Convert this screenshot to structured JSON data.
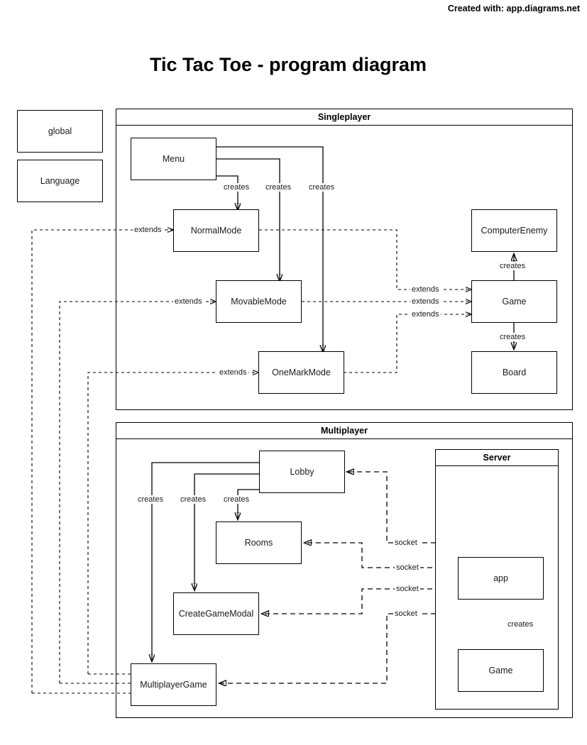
{
  "credit": "Created with: app.diagrams.net",
  "title": "Tic Tac Toe - program diagram",
  "standalone_nodes": [
    {
      "label": "global"
    },
    {
      "label": "Language"
    }
  ],
  "containers": [
    {
      "name": "Singleplayer",
      "nodes": [
        {
          "label": "Menu"
        },
        {
          "label": "NormalMode"
        },
        {
          "label": "MovableMode"
        },
        {
          "label": "OneMarkMode"
        },
        {
          "label": "ComputerEnemy"
        },
        {
          "label": "Game"
        },
        {
          "label": "Board"
        }
      ]
    },
    {
      "name": "Multiplayer",
      "nodes": [
        {
          "label": "Lobby"
        },
        {
          "label": "Rooms"
        },
        {
          "label": "CreateGameModal"
        },
        {
          "label": "MultiplayerGame"
        }
      ],
      "containers": [
        {
          "name": "Server",
          "nodes": [
            {
              "label": "app"
            },
            {
              "label": "Game"
            }
          ]
        }
      ]
    }
  ],
  "edge_labels": {
    "creates": "creates",
    "extends": "extends",
    "socket": "socket"
  },
  "edges": [
    {
      "from": "Menu",
      "to": "NormalMode",
      "label": "creates",
      "style": "solid"
    },
    {
      "from": "Menu",
      "to": "MovableMode",
      "label": "creates",
      "style": "solid"
    },
    {
      "from": "Menu",
      "to": "OneMarkMode",
      "label": "creates",
      "style": "solid"
    },
    {
      "from": "global",
      "to": "NormalMode",
      "label": "extends",
      "style": "dashed"
    },
    {
      "from": "global",
      "to": "MovableMode",
      "label": "extends",
      "style": "dashed"
    },
    {
      "from": "global",
      "to": "OneMarkMode",
      "label": "extends",
      "style": "dashed"
    },
    {
      "from": "NormalMode",
      "to": "Game",
      "label": "extends",
      "style": "dashed"
    },
    {
      "from": "MovableMode",
      "to": "Game",
      "label": "extends",
      "style": "dashed"
    },
    {
      "from": "OneMarkMode",
      "to": "Game",
      "label": "extends",
      "style": "dashed"
    },
    {
      "from": "Game",
      "to": "ComputerEnemy",
      "label": "creates",
      "style": "solid"
    },
    {
      "from": "Game",
      "to": "Board",
      "label": "creates",
      "style": "solid"
    },
    {
      "from": "Lobby",
      "to": "Rooms",
      "label": "creates",
      "style": "solid"
    },
    {
      "from": "Lobby",
      "to": "CreateGameModal",
      "label": "creates",
      "style": "solid"
    },
    {
      "from": "Lobby",
      "to": "MultiplayerGame",
      "label": "creates",
      "style": "solid"
    },
    {
      "from": "app",
      "to": "Lobby",
      "label": "socket",
      "style": "dashed"
    },
    {
      "from": "app",
      "to": "Rooms",
      "label": "socket",
      "style": "dashed"
    },
    {
      "from": "app",
      "to": "CreateGameModal",
      "label": "socket",
      "style": "dashed"
    },
    {
      "from": "app",
      "to": "MultiplayerGame",
      "label": "socket",
      "style": "dashed"
    },
    {
      "from": "app",
      "to": "Game",
      "label": "creates",
      "style": "solid"
    },
    {
      "from": "global",
      "to": "MultiplayerGame",
      "style": "dashed"
    }
  ],
  "labels": {
    "creates_menu_1": "creates",
    "creates_menu_2": "creates",
    "creates_menu_3": "creates",
    "extends_normal": "extends",
    "extends_movable": "extends",
    "extends_onemark": "extends",
    "extends_game_1": "extends",
    "extends_game_2": "extends",
    "extends_game_3": "extends",
    "creates_computerenemy": "creates",
    "creates_board": "creates",
    "creates_lobby_1": "creates",
    "creates_lobby_2": "creates",
    "creates_lobby_3": "creates",
    "socket_1": "socket",
    "socket_2": "socket",
    "socket_3": "socket",
    "socket_4": "socket",
    "creates_server_game": "creates"
  }
}
